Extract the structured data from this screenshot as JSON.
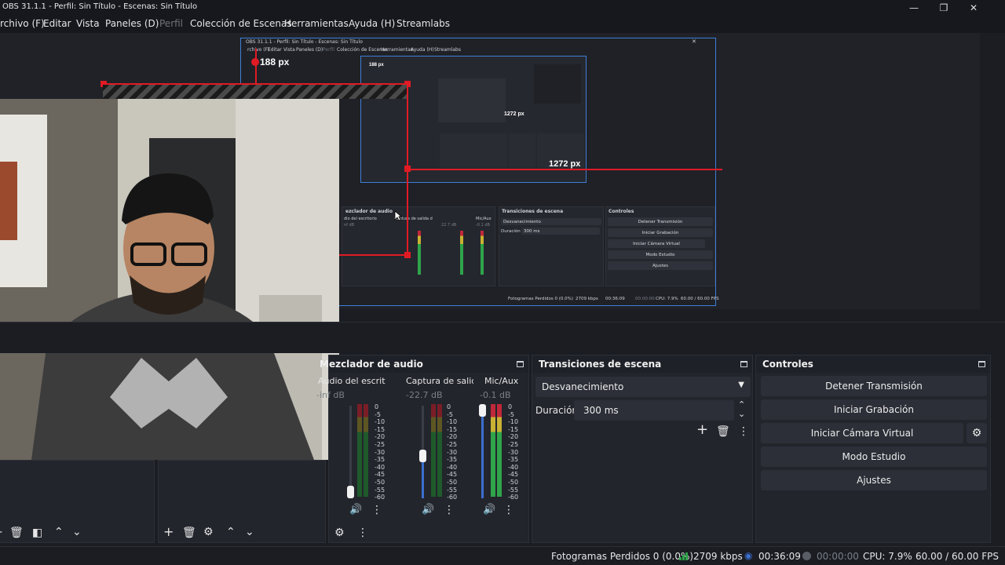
{
  "window": {
    "title": "OBS 31.1.1 - Perfil: Sin Título - Escenas: Sin Título",
    "controls": [
      "—",
      "❐",
      "✕"
    ]
  },
  "menu": [
    "rchivo (F)",
    "Editar",
    "Vista",
    "Paneles (D)",
    "Perfil",
    "Colección de Escenas",
    "Herramientas",
    "Ayuda (H)",
    "Streamlabs"
  ],
  "nested": {
    "title": "OBS 31.1.1 - Perfil: Sin Título - Escenas: Sin Título",
    "menu": [
      "rchivo (F)",
      "Editar",
      "Vista",
      "Paneles (D)",
      "Perfil",
      "Colección de Escenas",
      "Herramientas",
      "Ayuda (H)",
      "Streamlabs"
    ],
    "px_top": "188 px",
    "px_right": "1272 px",
    "px_inner": "1272 px",
    "px_inner_top": "188 px",
    "mixer_title": "ezclador de audio",
    "mixer_channels": [
      "dio del escritorio",
      "Captura de salida d",
      "Mic/Aux"
    ],
    "mixer_db": [
      "nf dB",
      "22.7 dB",
      "-0.1 dB"
    ],
    "transitions_title": "Transiciones de escena",
    "transition_value": "Desvanecimiento",
    "duration_label": "Duración",
    "duration_value": "300 ms",
    "controls_title": "Controles",
    "controls": [
      "Detener Transmisión",
      "Iniciar Grabación",
      "Iniciar Cámara Virtual",
      "Modo Estudio",
      "Ajustes"
    ],
    "status": [
      "Fotogramas Perdidos 0 (0.0%)",
      "2709 kbps",
      "00:36:09",
      "00:00:00",
      "CPU: 7.9%",
      "60.00 / 60.00 FPS"
    ]
  },
  "mixer": {
    "title": "Mezclador de audio",
    "channels": [
      {
        "name": "Audio del escritorio",
        "db": "-inf dB",
        "level": 0.05
      },
      {
        "name": "Captura de salida d",
        "db": "-22.7 dB",
        "level": 0.45
      },
      {
        "name": "Mic/Aux",
        "db": "-0.1 dB",
        "level": 0.95
      }
    ],
    "ticks": [
      "0",
      "-5",
      "-10",
      "-15",
      "-20",
      "-25",
      "-30",
      "-35",
      "-40",
      "-45",
      "-50",
      "-55",
      "-60"
    ]
  },
  "transitions": {
    "title": "Transiciones de escena",
    "selected": "Desvanecimiento",
    "duration_label": "Duración",
    "duration_value": "300 ms"
  },
  "controls": {
    "title": "Controles",
    "stop_stream": "Detener Transmisión",
    "start_recording": "Iniciar Grabación",
    "start_virtual_cam": "Iniciar Cámara Virtual",
    "studio_mode": "Modo Estudio",
    "settings": "Ajustes"
  },
  "status": {
    "dropped_frames": "Fotogramas Perdidos 0 (0.0%)",
    "bitrate": "2709 kbps",
    "stream_time": "00:36:09",
    "record_time": "00:00:00",
    "cpu": "CPU: 7.9%",
    "fps": "60.00 / 60.00 FPS"
  },
  "colors": {
    "accent": "#3b6fd1",
    "selection": "#e01b24",
    "meter_green": "#2fa44a",
    "meter_yellow": "#c9b233",
    "meter_red": "#c0283a"
  }
}
